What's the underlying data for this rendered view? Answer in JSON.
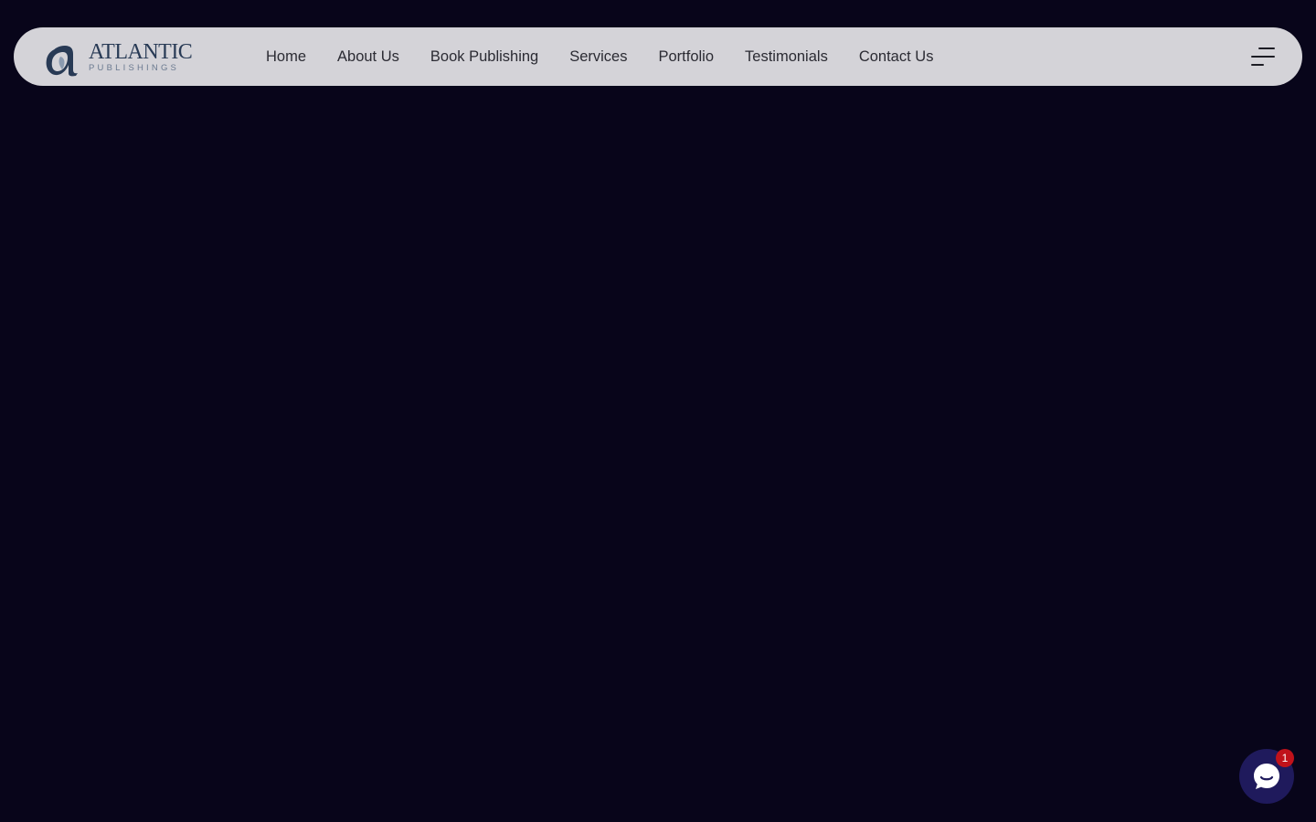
{
  "brand": {
    "name": "ATLANTIC",
    "tagline": "PUBLISHINGS",
    "colors": {
      "primary": "#283a55",
      "nav_bg": "#d4d3d8",
      "page_bg": "#08051a",
      "chat_bg": "#1f1a5c",
      "badge_bg": "#c0121a"
    }
  },
  "nav": {
    "items": [
      {
        "label": "Home"
      },
      {
        "label": "About Us"
      },
      {
        "label": "Book Publishing"
      },
      {
        "label": "Services"
      },
      {
        "label": "Portfolio"
      },
      {
        "label": "Testimonials"
      },
      {
        "label": "Contact Us"
      }
    ],
    "menu_icon": "hamburger-menu-icon"
  },
  "chat": {
    "icon": "chat-bubble-icon",
    "badge_count": "1"
  }
}
